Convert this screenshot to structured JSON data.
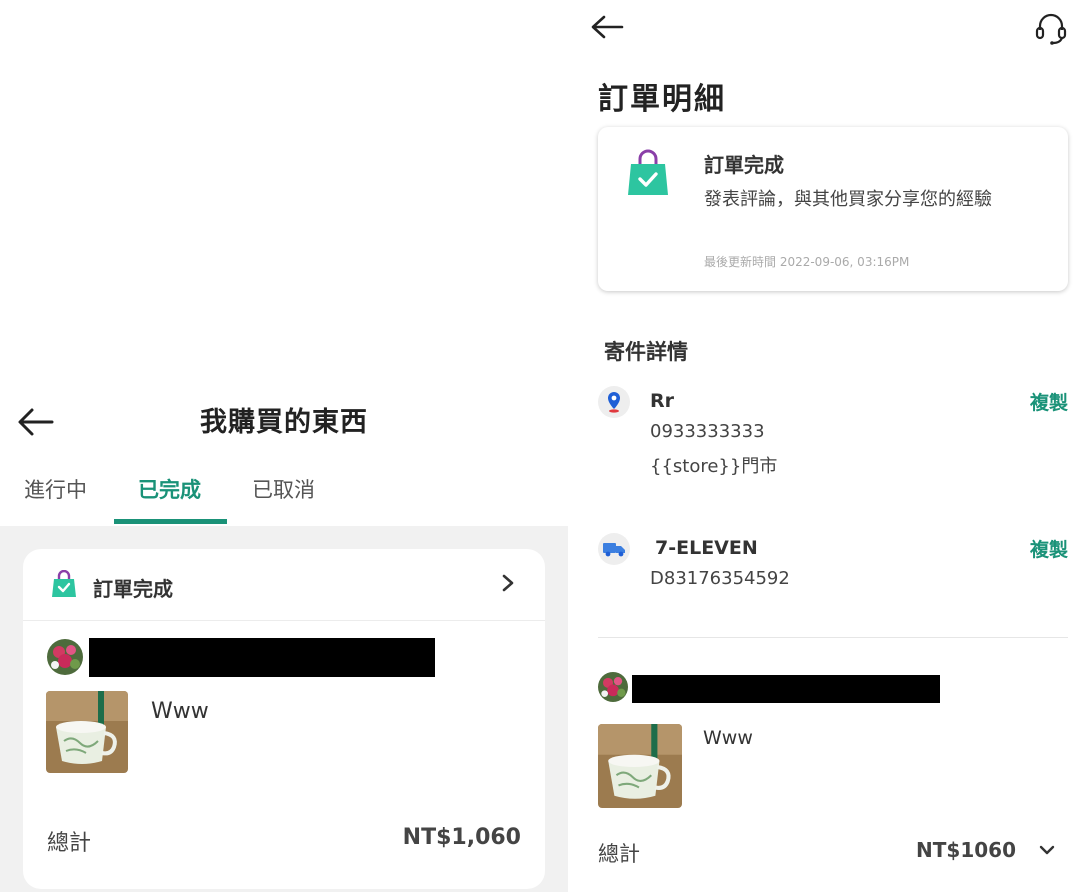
{
  "left": {
    "header_title": "我購買的東西",
    "tabs": [
      {
        "label": "進行中",
        "active": false
      },
      {
        "label": "已完成",
        "active": true
      },
      {
        "label": "已取消",
        "active": false
      }
    ],
    "order": {
      "status": "訂單完成",
      "product_name": "Www",
      "total_label": "總計",
      "total_value": "NT$1,060"
    }
  },
  "right": {
    "page_title": "訂單明細",
    "status_card": {
      "title": "訂單完成",
      "description": "發表評論，與其他買家分享您的經驗",
      "updated": "最後更新時間 2022-09-06, 03:16PM"
    },
    "shipping": {
      "section_title": "寄件詳情",
      "recipient": {
        "name": "Rr",
        "phone": "0933333333",
        "store": "{{store}}門市",
        "copy_label": "複製"
      },
      "carrier": {
        "name": "7-ELEVEN",
        "tracking": "D83176354592",
        "copy_label": "複製"
      }
    },
    "order": {
      "product_name": "Www",
      "total_label": "總計",
      "total_value": "NT$1060"
    }
  },
  "colors": {
    "accent": "#1a9278",
    "bag": "#2dc5a0",
    "bag_handle": "#8a3fa8",
    "location_pin": "#1f5fd6",
    "truck": "#3c7fe0"
  },
  "icons": [
    "back-arrow-icon",
    "headset-icon",
    "shopping-bag-icon",
    "chevron-right-icon",
    "chevron-down-icon",
    "location-pin-icon",
    "truck-icon"
  ]
}
